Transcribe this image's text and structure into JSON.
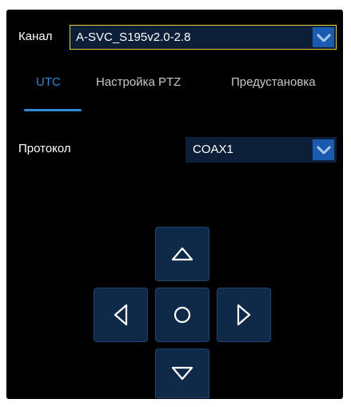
{
  "channel": {
    "label": "Канал",
    "value": "A-SVC_S195v2.0-2.8"
  },
  "tabs": [
    {
      "label": "UTC",
      "active": true
    },
    {
      "label": "Настройка PTZ",
      "active": false
    },
    {
      "label": "Предустановка",
      "active": false
    }
  ],
  "protocol": {
    "label": "Протокол",
    "value": "COAX1"
  },
  "ptz_controls": [
    "up-icon",
    "left-icon",
    "center-circle-icon",
    "right-icon",
    "down-icon"
  ],
  "colors": {
    "accent": "#2f8ad8",
    "panel_bg": "#000000",
    "control_bg": "#0f2a48",
    "select_arrow_bg": "#1a5bb0",
    "focus_border": "#e6d23c"
  }
}
